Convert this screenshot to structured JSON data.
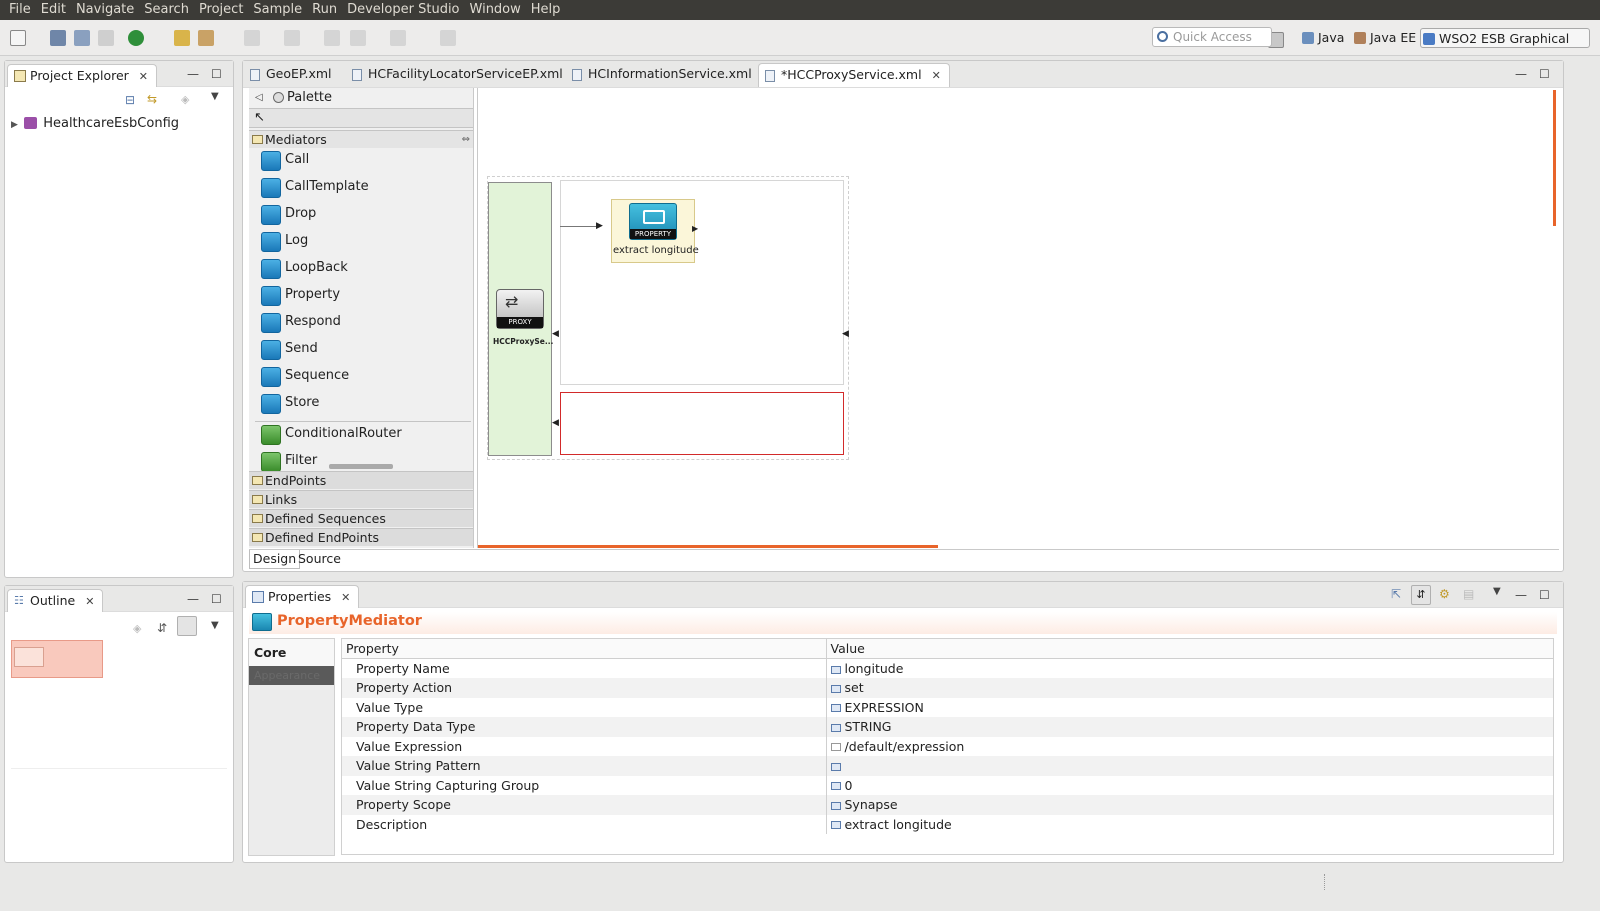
{
  "menubar": {
    "items": [
      "File",
      "Edit",
      "Navigate",
      "Search",
      "Project",
      "Sample",
      "Run",
      "Developer Studio",
      "Window",
      "Help"
    ]
  },
  "toolbar": {
    "quick_access_placeholder": "Quick Access",
    "perspectives": [
      "Java",
      "Java EE",
      "WSO2 ESB Graphical"
    ]
  },
  "project_explorer": {
    "title": "Project Explorer",
    "tree": [
      {
        "label": "HealthcareEsbConfig"
      }
    ]
  },
  "outline": {
    "title": "Outline"
  },
  "editor": {
    "tabs": [
      {
        "label": "GeoEP.xml",
        "active": false
      },
      {
        "label": "HCFacilityLocatorServiceEP.xml",
        "active": false
      },
      {
        "label": "HCInformationService.xml",
        "active": false
      },
      {
        "label": "*HCCProxyService.xml",
        "active": true
      }
    ],
    "bottom_tabs": [
      "Design",
      "Source"
    ],
    "palette": {
      "title": "Palette",
      "mediators_label": "Mediators",
      "mediators": [
        {
          "label": "Call",
          "icon": "call-icon"
        },
        {
          "label": "CallTemplate",
          "icon": "call-template-icon"
        },
        {
          "label": "Drop",
          "icon": "drop-icon"
        },
        {
          "label": "Log",
          "icon": "log-icon"
        },
        {
          "label": "LoopBack",
          "icon": "loopback-icon"
        },
        {
          "label": "Property",
          "icon": "property-icon"
        },
        {
          "label": "Respond",
          "icon": "respond-icon"
        },
        {
          "label": "Send",
          "icon": "send-icon"
        },
        {
          "label": "Sequence",
          "icon": "sequence-icon"
        },
        {
          "label": "Store",
          "icon": "store-icon"
        },
        {
          "label": "ConditionalRouter",
          "icon": "conditional-router-icon"
        },
        {
          "label": "Filter",
          "icon": "filter-icon"
        }
      ],
      "drawers": [
        "EndPoints",
        "Links",
        "Defined Sequences",
        "Defined EndPoints"
      ]
    },
    "diagram": {
      "proxy_badge": "PROXY",
      "proxy_name": "HCCProxySe...",
      "mediator_badge": "PROPERTY",
      "mediator_label": "extract longitude"
    }
  },
  "properties": {
    "title": "Properties",
    "heading": "PropertyMediator",
    "tabs": [
      "Core",
      "Appearance"
    ],
    "columns": [
      "Property",
      "Value"
    ],
    "rows": [
      {
        "property": "Property Name",
        "value": "longitude"
      },
      {
        "property": "Property Action",
        "value": "set"
      },
      {
        "property": "Value Type",
        "value": "EXPRESSION"
      },
      {
        "property": "Property Data Type",
        "value": "STRING"
      },
      {
        "property": "Value Expression",
        "value": "/default/expression"
      },
      {
        "property": "Value String Pattern",
        "value": ""
      },
      {
        "property": "Value String Capturing Group",
        "value": "0"
      },
      {
        "property": "Property Scope",
        "value": "Synapse"
      },
      {
        "property": "Description",
        "value": "extract longitude"
      }
    ]
  },
  "colors": {
    "accent_orange": "#e8642a",
    "proxy_green": "#e2f3d8",
    "fault_red": "#d22a2a"
  }
}
